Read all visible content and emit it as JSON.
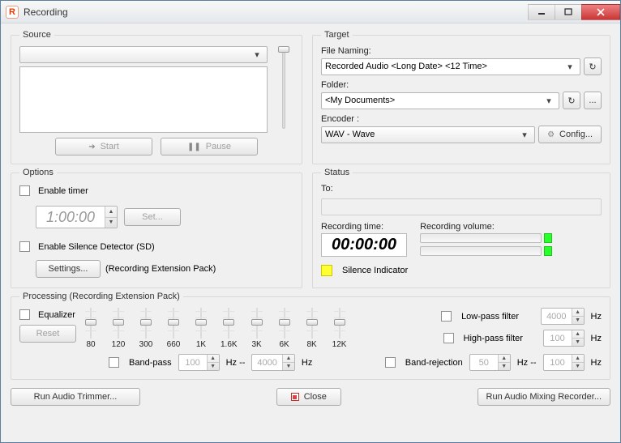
{
  "window": {
    "title": "Recording",
    "appicon_letter": "R"
  },
  "source": {
    "legend": "Source",
    "combo_value": "",
    "start": "Start",
    "pause": "Pause"
  },
  "target": {
    "legend": "Target",
    "file_naming_label": "File Naming:",
    "file_naming_value": "Recorded Audio <Long Date> <12 Time>",
    "folder_label": "Folder:",
    "folder_value": "<My Documents>",
    "encoder_label": "Encoder :",
    "encoder_value": "WAV - Wave",
    "config_btn": "Config...",
    "refresh_icon": "↻",
    "browse_icon": "..."
  },
  "options": {
    "legend": "Options",
    "enable_timer": "Enable timer",
    "timer_value": "1:00:00",
    "set_btn": "Set...",
    "enable_sd": "Enable Silence Detector (SD)",
    "settings_btn": "Settings...",
    "rep_note": "(Recording Extension Pack)"
  },
  "status": {
    "legend": "Status",
    "to_label": "To:",
    "rec_time_label": "Recording time:",
    "rec_time_value": "00:00:00",
    "rec_vol_label": "Recording volume:",
    "silence_label": "Silence Indicator"
  },
  "processing": {
    "legend": "Processing (Recording Extension Pack)",
    "equalizer": "Equalizer",
    "reset_btn": "Reset",
    "bands": [
      "80",
      "120",
      "300",
      "660",
      "1K",
      "1.6K",
      "3K",
      "6K",
      "8K",
      "12K"
    ],
    "lowpass_label": "Low-pass filter",
    "lowpass_value": "4000",
    "highpass_label": "High-pass filter",
    "highpass_value": "100",
    "bandpass_label": "Band-pass",
    "bandpass_lo": "100",
    "bandpass_hi": "4000",
    "bandrej_label": "Band-rejection",
    "bandrej_lo": "50",
    "bandrej_hi": "100",
    "hz": "Hz",
    "hz_sep": "Hz --"
  },
  "bottom": {
    "trimmer": "Run Audio Trimmer...",
    "close": "Close",
    "mixer": "Run Audio Mixing Recorder..."
  }
}
